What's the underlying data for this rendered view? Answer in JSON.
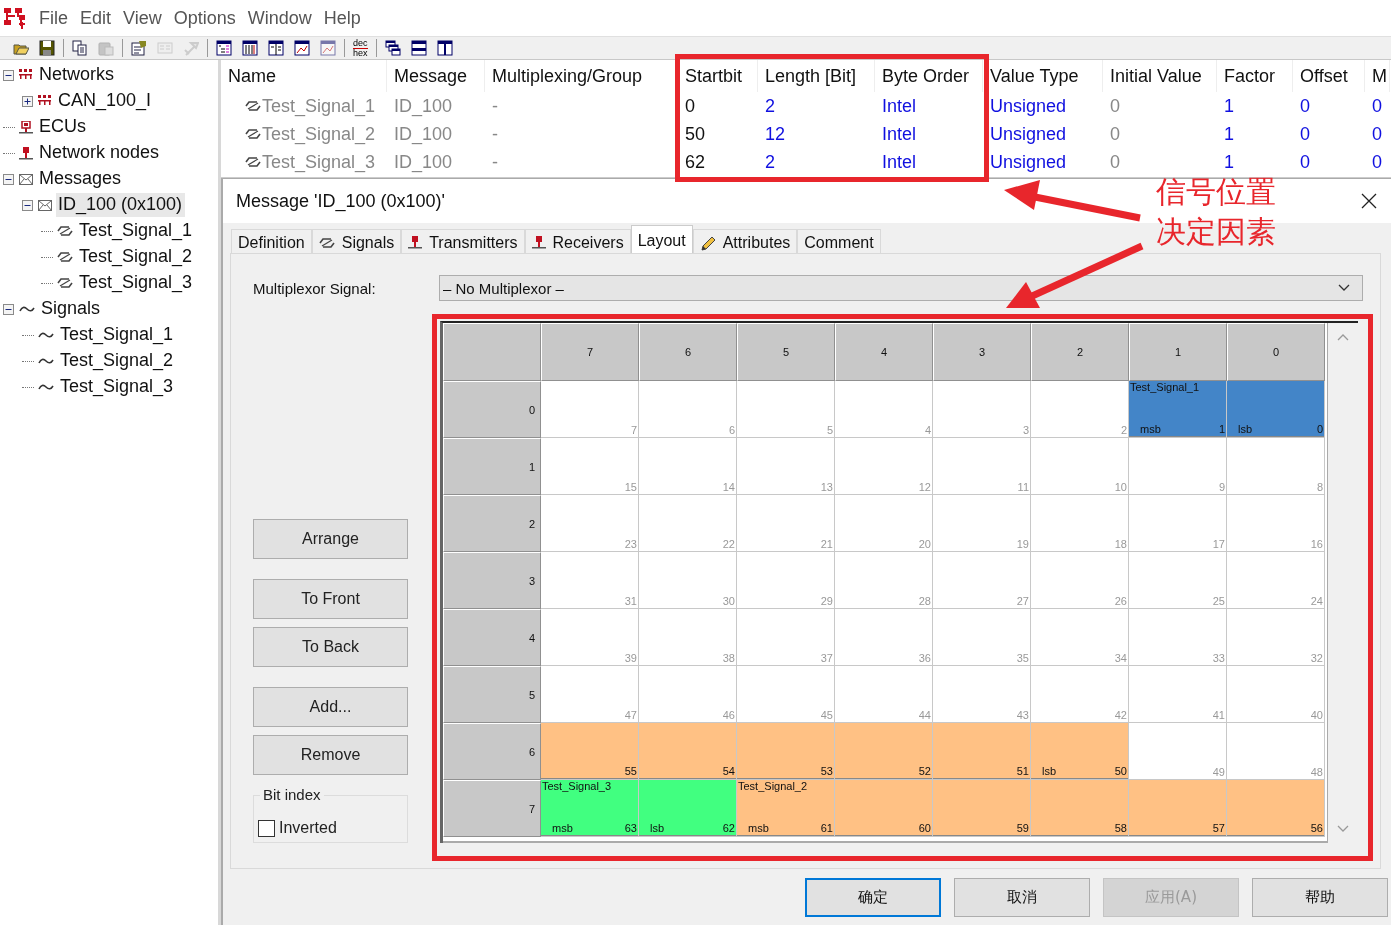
{
  "menu": {
    "items": [
      "File",
      "Edit",
      "View",
      "Options",
      "Window",
      "Help"
    ]
  },
  "toolbar": [
    {
      "kind": "open",
      "disabled": false
    },
    {
      "kind": "save",
      "disabled": false
    },
    {
      "kind": "separator"
    },
    {
      "kind": "copy",
      "disabled": false
    },
    {
      "kind": "paste",
      "disabled": true
    },
    {
      "kind": "separator"
    },
    {
      "kind": "properties",
      "disabled": false
    },
    {
      "kind": "card",
      "disabled": true
    },
    {
      "kind": "tool",
      "disabled": true
    },
    {
      "kind": "separator"
    },
    {
      "kind": "tree-view",
      "disabled": false
    },
    {
      "kind": "columns",
      "disabled": false
    },
    {
      "kind": "panes",
      "disabled": false
    },
    {
      "kind": "chart",
      "disabled": false
    },
    {
      "kind": "chart",
      "disabled": true
    },
    {
      "kind": "separator"
    },
    {
      "kind": "dechex",
      "labels": [
        "dec",
        "hex"
      ],
      "disabled": false
    },
    {
      "kind": "separator"
    },
    {
      "kind": "cascade",
      "disabled": false
    },
    {
      "kind": "tile-horizontal",
      "disabled": false
    },
    {
      "kind": "tile-vertical",
      "disabled": false
    }
  ],
  "tree": [
    {
      "label": "Networks",
      "kind": "network",
      "expanded": true,
      "selected": false,
      "children": [
        {
          "label": "CAN_100_I",
          "kind": "network",
          "expanded": false,
          "selected": false
        }
      ]
    },
    {
      "label": "ECUs",
      "kind": "ecu",
      "selected": false
    },
    {
      "label": "Network nodes",
      "kind": "node",
      "selected": false
    },
    {
      "label": "Messages",
      "kind": "message",
      "expanded": true,
      "selected": false,
      "children": [
        {
          "label": "ID_100 (0x100)",
          "kind": "message",
          "expanded": true,
          "selected": true,
          "children": [
            {
              "label": "Test_Signal_1",
              "kind": "signal",
              "selected": false
            },
            {
              "label": "Test_Signal_2",
              "kind": "signal",
              "selected": false
            },
            {
              "label": "Test_Signal_3",
              "kind": "signal",
              "selected": false
            }
          ]
        }
      ]
    },
    {
      "label": "Signals",
      "kind": "wave",
      "expanded": true,
      "selected": false,
      "children": [
        {
          "label": "Test_Signal_1",
          "kind": "wave",
          "selected": false
        },
        {
          "label": "Test_Signal_2",
          "kind": "wave",
          "selected": false
        },
        {
          "label": "Test_Signal_3",
          "kind": "wave",
          "selected": false
        }
      ]
    }
  ],
  "signal_table": {
    "columns": [
      {
        "label": "Name",
        "kind": "muted"
      },
      {
        "label": "Message",
        "kind": "muted"
      },
      {
        "label": "Multiplexing/Group",
        "kind": "muted"
      },
      {
        "label": "Startbit",
        "kind": "plain"
      },
      {
        "label": "Length [Bit]",
        "kind": "editable"
      },
      {
        "label": "Byte Order",
        "kind": "editable"
      },
      {
        "label": "Value Type",
        "kind": "editable"
      },
      {
        "label": "Initial Value",
        "kind": "muted"
      },
      {
        "label": "Factor",
        "kind": "editable"
      },
      {
        "label": "Offset",
        "kind": "editable"
      },
      {
        "label": "M",
        "kind": "editable"
      }
    ],
    "rows": [
      [
        "Test_Signal_1",
        "ID_100",
        "-",
        "0",
        "2",
        "Intel",
        "Unsigned",
        "0",
        "1",
        "0",
        "0"
      ],
      [
        "Test_Signal_2",
        "ID_100",
        "-",
        "50",
        "12",
        "Intel",
        "Unsigned",
        "0",
        "1",
        "0",
        "0"
      ],
      [
        "Test_Signal_3",
        "ID_100",
        "-",
        "62",
        "2",
        "Intel",
        "Unsigned",
        "0",
        "1",
        "0",
        "0"
      ]
    ]
  },
  "dialog": {
    "title": "Message 'ID_100 (0x100)'",
    "tabs": [
      {
        "label": "Definition",
        "kind": "plain",
        "selected": false
      },
      {
        "label": "Signals",
        "kind": "signal",
        "selected": false
      },
      {
        "label": "Transmitters",
        "kind": "node",
        "selected": false
      },
      {
        "label": "Receivers",
        "kind": "node",
        "selected": false
      },
      {
        "label": "Layout",
        "kind": "plain",
        "selected": true
      },
      {
        "label": "Attributes",
        "kind": "pencil",
        "selected": false
      },
      {
        "label": "Comment",
        "kind": "plain",
        "selected": false
      }
    ],
    "multiplexor": {
      "label": "Multiplexor Signal:",
      "value": "– No Multiplexor –"
    },
    "buttons": [
      "Arrange",
      "To Front",
      "To Back",
      "Add...",
      "Remove"
    ],
    "bit_index": {
      "title": "Bit index",
      "inverted": {
        "label": "Inverted",
        "checked": false
      }
    },
    "grid": {
      "columns": [
        "7",
        "6",
        "5",
        "4",
        "3",
        "2",
        "1",
        "0"
      ],
      "rows": [
        {
          "label": "0",
          "cells": [
            {
              "bit": "7"
            },
            {
              "bit": "6"
            },
            {
              "bit": "5"
            },
            {
              "bit": "4"
            },
            {
              "bit": "3"
            },
            {
              "bit": "2"
            },
            {
              "bit": "1",
              "color": "#4385c8",
              "name": "Test_Signal_1",
              "tag": "msb"
            },
            {
              "bit": "0",
              "color": "#4385c8",
              "tag": "lsb"
            }
          ]
        },
        {
          "label": "1",
          "cells": [
            {
              "bit": "15"
            },
            {
              "bit": "14"
            },
            {
              "bit": "13"
            },
            {
              "bit": "12"
            },
            {
              "bit": "11"
            },
            {
              "bit": "10"
            },
            {
              "bit": "9"
            },
            {
              "bit": "8"
            }
          ]
        },
        {
          "label": "2",
          "cells": [
            {
              "bit": "23"
            },
            {
              "bit": "22"
            },
            {
              "bit": "21"
            },
            {
              "bit": "20"
            },
            {
              "bit": "19"
            },
            {
              "bit": "18"
            },
            {
              "bit": "17"
            },
            {
              "bit": "16"
            }
          ]
        },
        {
          "label": "3",
          "cells": [
            {
              "bit": "31"
            },
            {
              "bit": "30"
            },
            {
              "bit": "29"
            },
            {
              "bit": "28"
            },
            {
              "bit": "27"
            },
            {
              "bit": "26"
            },
            {
              "bit": "25"
            },
            {
              "bit": "24"
            }
          ]
        },
        {
          "label": "4",
          "cells": [
            {
              "bit": "39"
            },
            {
              "bit": "38"
            },
            {
              "bit": "37"
            },
            {
              "bit": "36"
            },
            {
              "bit": "35"
            },
            {
              "bit": "34"
            },
            {
              "bit": "33"
            },
            {
              "bit": "32"
            }
          ]
        },
        {
          "label": "5",
          "cells": [
            {
              "bit": "47"
            },
            {
              "bit": "46"
            },
            {
              "bit": "45"
            },
            {
              "bit": "44"
            },
            {
              "bit": "43"
            },
            {
              "bit": "42"
            },
            {
              "bit": "41"
            },
            {
              "bit": "40"
            }
          ]
        },
        {
          "label": "6",
          "cells": [
            {
              "bit": "55",
              "color": "#ffc184"
            },
            {
              "bit": "54",
              "color": "#ffc184"
            },
            {
              "bit": "53",
              "color": "#ffc184"
            },
            {
              "bit": "52",
              "color": "#ffc184"
            },
            {
              "bit": "51",
              "color": "#ffc184"
            },
            {
              "bit": "50",
              "color": "#ffc184",
              "tag": "lsb"
            },
            {
              "bit": "49"
            },
            {
              "bit": "48"
            }
          ]
        },
        {
          "label": "7",
          "cells": [
            {
              "bit": "63",
              "color": "#41ff80",
              "name": "Test_Signal_3",
              "tag": "msb"
            },
            {
              "bit": "62",
              "color": "#41ff80",
              "tag": "lsb"
            },
            {
              "bit": "61",
              "color": "#ffc184",
              "name": "Test_Signal_2",
              "tag": "msb"
            },
            {
              "bit": "60",
              "color": "#ffc184"
            },
            {
              "bit": "59",
              "color": "#ffc184"
            },
            {
              "bit": "58",
              "color": "#ffc184"
            },
            {
              "bit": "57",
              "color": "#ffc184"
            },
            {
              "bit": "56",
              "color": "#ffc184"
            }
          ]
        }
      ]
    },
    "footer": [
      {
        "label": "确定",
        "default": true,
        "disabled": false
      },
      {
        "label": "取消",
        "default": false,
        "disabled": false
      },
      {
        "label": "应用(A)",
        "default": false,
        "disabled": true
      },
      {
        "label": "帮助",
        "default": false,
        "disabled": false
      }
    ]
  },
  "annotation": {
    "lines": [
      "信号位置",
      "决定因素"
    ]
  }
}
